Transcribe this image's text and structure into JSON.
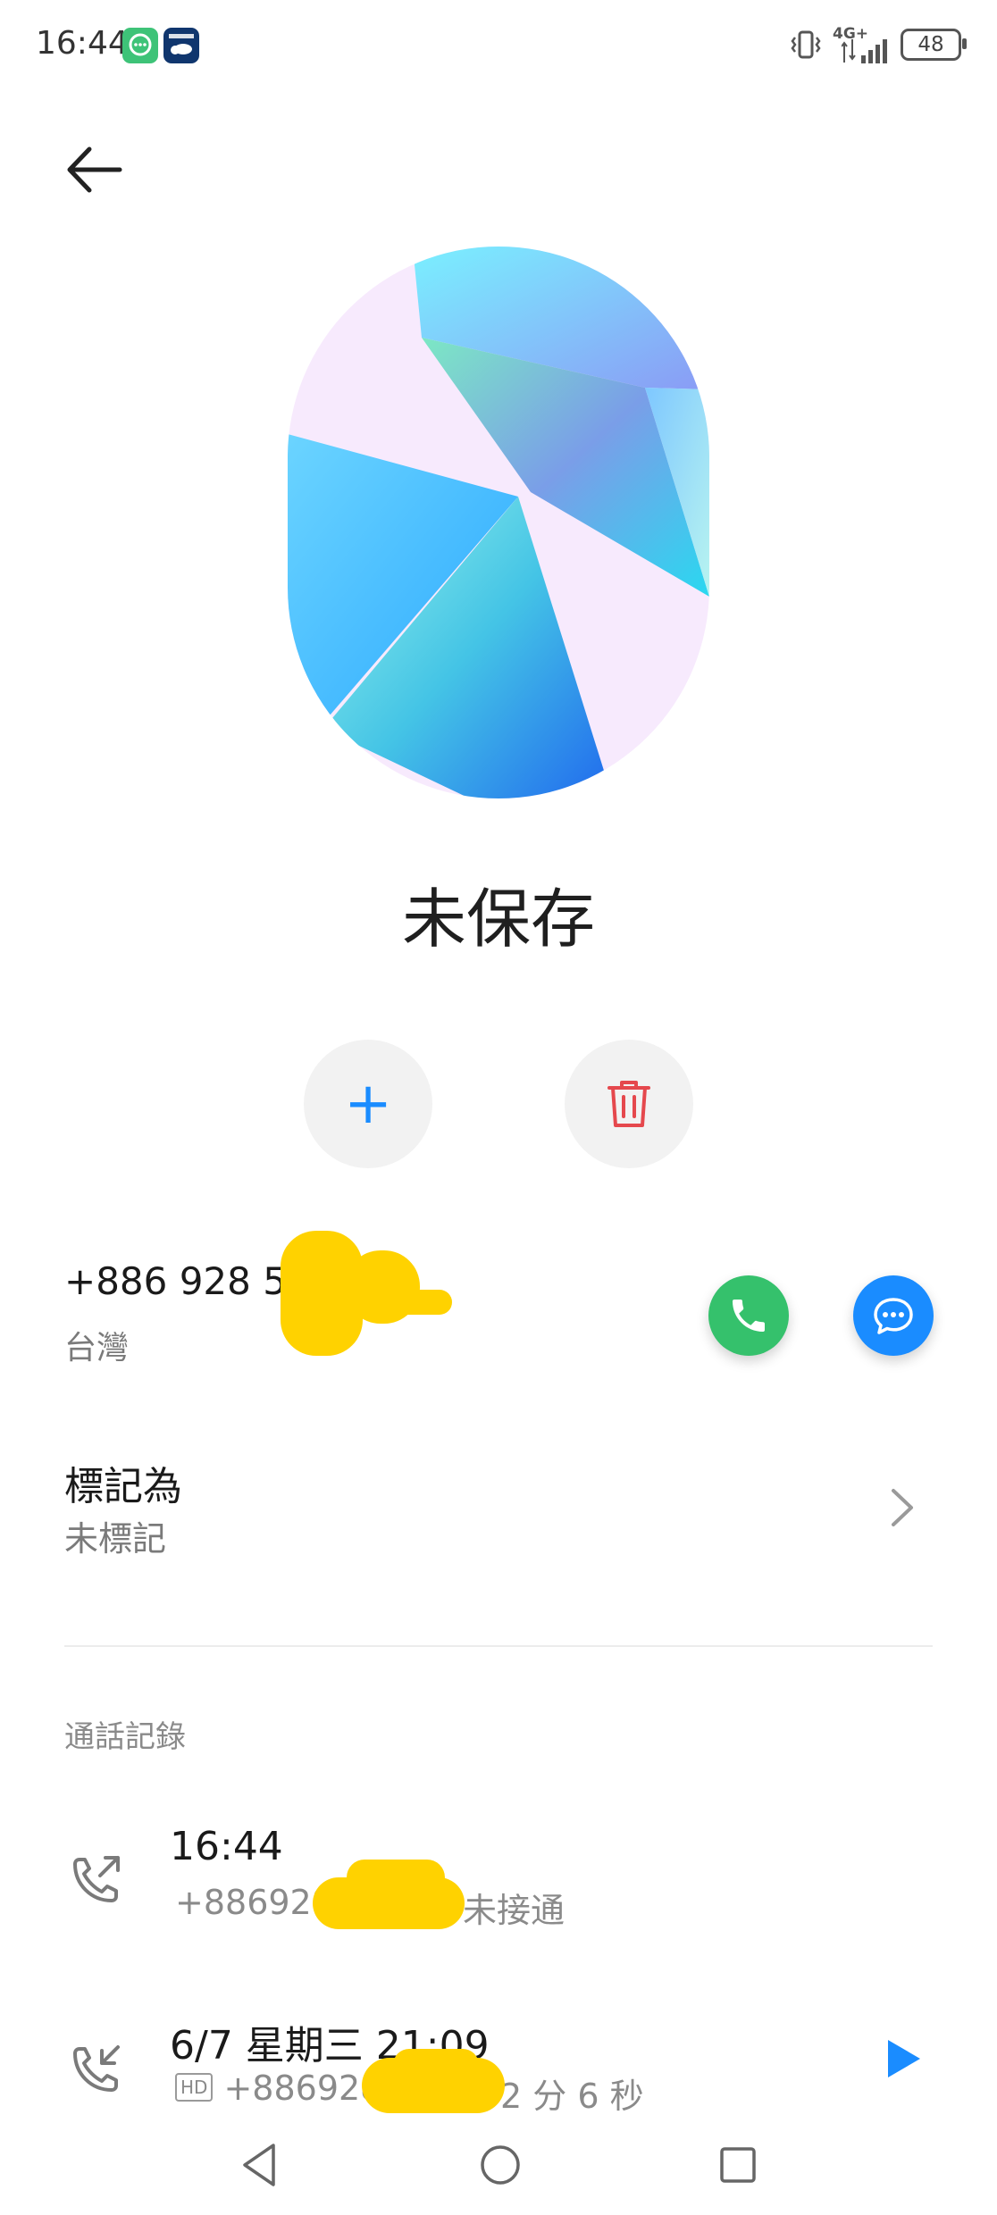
{
  "status_bar": {
    "time": "16:44",
    "network": "4G+",
    "battery": "48"
  },
  "contact": {
    "title": "未保存",
    "phone_number": "+886 928 5",
    "region": "台灣"
  },
  "actions": {
    "add_symbol": "+"
  },
  "mark": {
    "label": "標記為",
    "value": "未標記"
  },
  "call_log": {
    "title": "通話記錄",
    "entries": [
      {
        "time": "16:44",
        "number": "+886928",
        "detail": "未接通",
        "type": "outgoing"
      },
      {
        "time": "6/7 星期三 21:09",
        "badge": "HD",
        "number": "+8869285",
        "detail": "2 分 6 秒",
        "type": "incoming"
      }
    ]
  },
  "colors": {
    "call_green": "#35c16c",
    "message_blue": "#1a8cff",
    "accent_blue": "#1a8cff",
    "delete_red": "#e5484d",
    "redaction_yellow": "#ffd200"
  },
  "icons": [
    "back-arrow-icon",
    "add-contact-icon",
    "trash-icon",
    "phone-icon",
    "chat-bubble-icon",
    "chevron-right-icon",
    "outgoing-call-icon",
    "incoming-call-icon",
    "play-icon",
    "nav-back-icon",
    "nav-home-icon",
    "nav-recents-icon"
  ]
}
